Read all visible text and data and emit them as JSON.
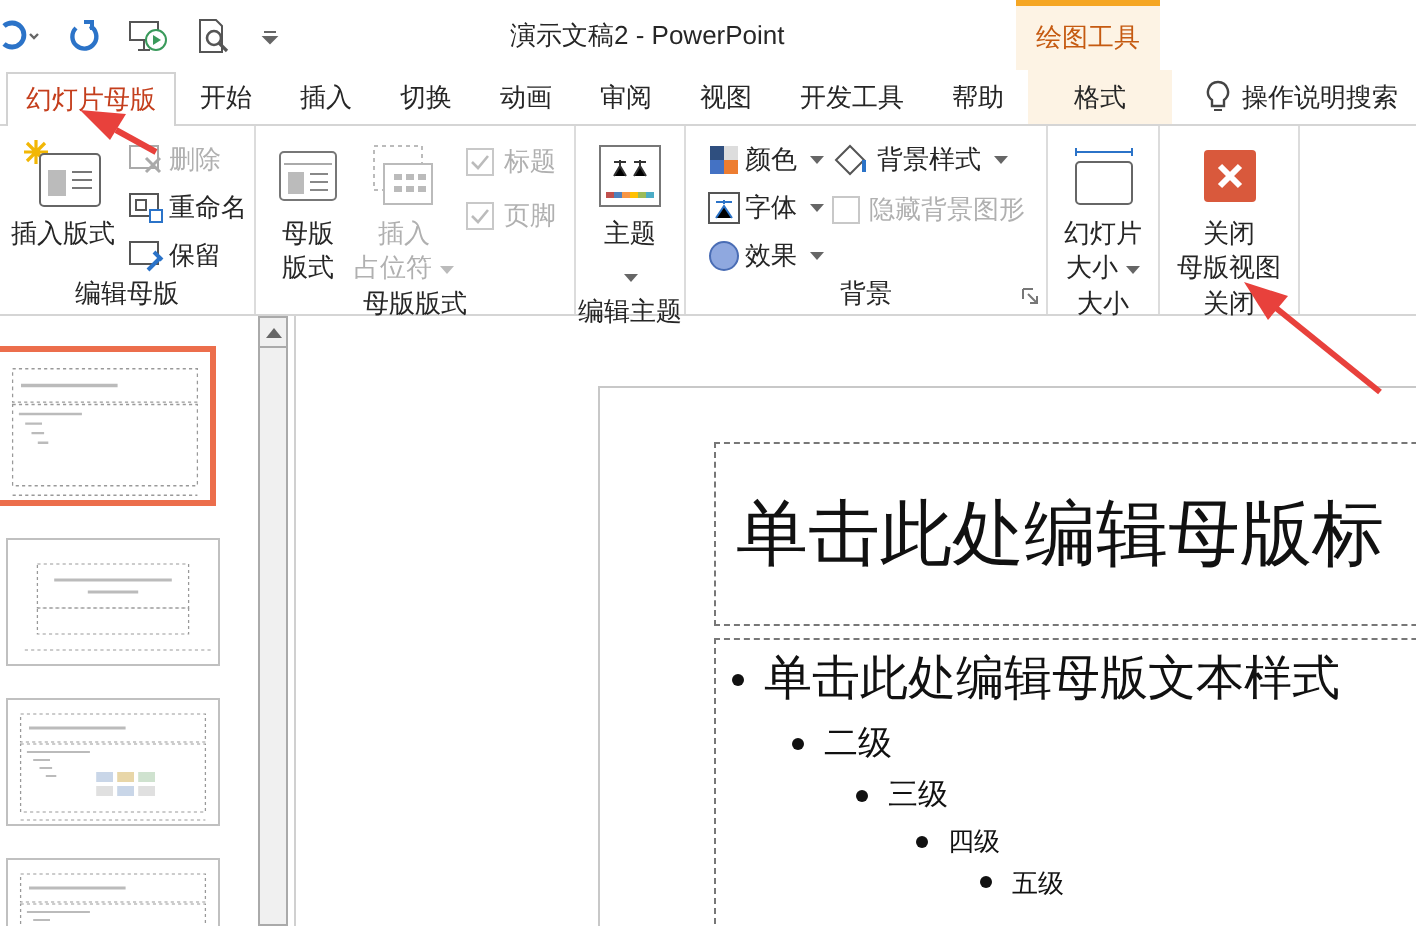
{
  "window": {
    "title": "演示文稿2  -  PowerPoint"
  },
  "contextual_group": "绘图工具",
  "tabs": [
    {
      "label": "幻灯片母版",
      "selected": true,
      "contextual": false
    },
    {
      "label": "开始",
      "selected": false,
      "contextual": false
    },
    {
      "label": "插入",
      "selected": false,
      "contextual": false
    },
    {
      "label": "切换",
      "selected": false,
      "contextual": false
    },
    {
      "label": "动画",
      "selected": false,
      "contextual": false
    },
    {
      "label": "审阅",
      "selected": false,
      "contextual": false
    },
    {
      "label": "视图",
      "selected": false,
      "contextual": false
    },
    {
      "label": "开发工具",
      "selected": false,
      "contextual": false
    },
    {
      "label": "帮助",
      "selected": false,
      "contextual": false
    },
    {
      "label": "格式",
      "selected": false,
      "contextual": true
    }
  ],
  "tell_me": "操作说明搜索",
  "ribbon_groups": [
    {
      "label": "编辑母版",
      "launcher": false,
      "items": [
        {
          "kind": "large",
          "lines": [
            "插入版式"
          ],
          "dropdown": false,
          "disabled": false
        },
        {
          "kind": "stack",
          "items": [
            {
              "kind": "small",
              "label": "删除",
              "dropdown": false,
              "disabled": true
            },
            {
              "kind": "small",
              "label": "重命名",
              "dropdown": false,
              "disabled": false
            },
            {
              "kind": "small",
              "label": "保留",
              "dropdown": false,
              "disabled": false
            }
          ]
        }
      ]
    },
    {
      "label": "母版版式",
      "launcher": false,
      "items": [
        {
          "kind": "large",
          "lines": [
            "母版",
            "版式"
          ],
          "dropdown": false,
          "disabled": false
        },
        {
          "kind": "large",
          "lines": [
            "插入",
            "占位符"
          ],
          "dropdown": true,
          "disabled": true
        },
        {
          "kind": "stack",
          "items": [
            {
              "kind": "check",
              "label": "标题",
              "checked": true,
              "disabled": true
            },
            {
              "kind": "check",
              "label": "页脚",
              "checked": true,
              "disabled": true
            }
          ]
        }
      ]
    },
    {
      "label": "编辑主题",
      "launcher": false,
      "items": [
        {
          "kind": "large",
          "lines": [
            "主题"
          ],
          "dropdown": true,
          "disabled": false
        }
      ]
    },
    {
      "label": "背景",
      "launcher": true,
      "items": [
        {
          "kind": "stack",
          "items": [
            {
              "kind": "small",
              "label": "颜色",
              "dropdown": true,
              "disabled": false
            },
            {
              "kind": "small",
              "label": "字体",
              "dropdown": true,
              "disabled": false
            },
            {
              "kind": "small",
              "label": "效果",
              "dropdown": true,
              "disabled": false
            }
          ]
        },
        {
          "kind": "stack",
          "items": [
            {
              "kind": "small",
              "label": "背景样式",
              "dropdown": true,
              "disabled": false
            },
            {
              "kind": "check",
              "label": "隐藏背景图形",
              "checked": false,
              "disabled": true
            }
          ]
        }
      ]
    },
    {
      "label": "大小",
      "launcher": false,
      "items": [
        {
          "kind": "large",
          "lines": [
            "幻灯片",
            "大小"
          ],
          "dropdown": true,
          "disabled": false
        }
      ]
    },
    {
      "label": "关闭",
      "launcher": false,
      "items": [
        {
          "kind": "large",
          "lines": [
            "关闭",
            "母版视图"
          ],
          "dropdown": false,
          "disabled": false
        }
      ]
    }
  ],
  "thumbnails": [
    {
      "selected": true
    },
    {
      "selected": false
    },
    {
      "selected": false
    },
    {
      "selected": false
    }
  ],
  "slide": {
    "title": "单击此处编辑母版标",
    "bullets": [
      {
        "text": "单击此处编辑母版文本样式",
        "children": [
          {
            "text": "二级",
            "children": [
              {
                "text": "三级",
                "children": [
                  {
                    "text": "四级",
                    "children": [
                      {
                        "text": "五级"
                      }
                    ]
                  }
                ]
              }
            ]
          }
        ]
      }
    ]
  }
}
